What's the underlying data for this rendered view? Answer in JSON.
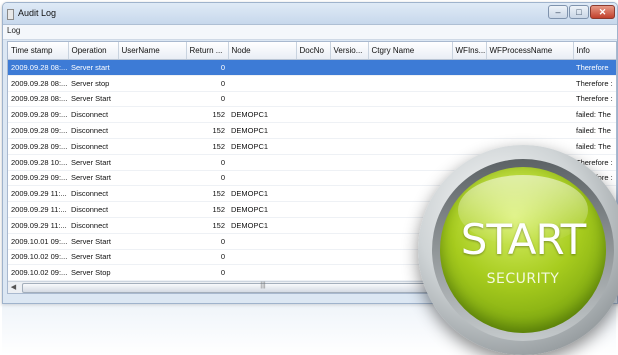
{
  "window": {
    "title": "Audit Log",
    "buttons": {
      "minimize": "–",
      "maximize": "□",
      "close": "✕"
    }
  },
  "menu": {
    "items": [
      "Log"
    ]
  },
  "table": {
    "columns": [
      "Time stamp",
      "Operation",
      "UserName",
      "Return ...",
      "Node",
      "DocNo",
      "Versio...",
      "Ctgry Name",
      "WFIns...",
      "WFProcessName",
      "Info"
    ],
    "rows": [
      [
        "2009.09.28 08:...",
        "Server start",
        "",
        "0",
        "",
        "",
        "",
        "",
        "",
        "",
        "Therefore"
      ],
      [
        "2009.09.28 08:...",
        "Server stop",
        "",
        "0",
        "",
        "",
        "",
        "",
        "",
        "",
        "Therefore :"
      ],
      [
        "2009.09.28 08:...",
        "Server Start",
        "",
        "0",
        "",
        "",
        "",
        "",
        "",
        "",
        "Therefore :"
      ],
      [
        "2009.09.28 09:...",
        "Disconnect",
        "",
        "152",
        "DEMOPC1",
        "",
        "",
        "",
        "",
        "",
        "failed: The"
      ],
      [
        "2009.09.28 09:...",
        "Disconnect",
        "",
        "152",
        "DEMOPC1",
        "",
        "",
        "",
        "",
        "",
        "failed: The"
      ],
      [
        "2009.09.28 09:...",
        "Disconnect",
        "",
        "152",
        "DEMOPC1",
        "",
        "",
        "",
        "",
        "",
        "failed: The"
      ],
      [
        "2009.09.28 10:...",
        "Server Start",
        "",
        "0",
        "",
        "",
        "",
        "",
        "",
        "",
        "Therefore :"
      ],
      [
        "2009.09.29 09:...",
        "Server Start",
        "",
        "0",
        "",
        "",
        "",
        "",
        "",
        "",
        "Therefore :"
      ],
      [
        "2009.09.29 11:...",
        "Disconnect",
        "",
        "152",
        "DEMOPC1",
        "",
        "",
        "",
        "",
        "",
        "d: The"
      ],
      [
        "2009.09.29 11:...",
        "Disconnect",
        "",
        "152",
        "DEMOPC1",
        "",
        "",
        "",
        "",
        "",
        ": The"
      ],
      [
        "2009.09.29 11:...",
        "Disconnect",
        "",
        "152",
        "DEMOPC1",
        "",
        "",
        "",
        "",
        "",
        "The"
      ],
      [
        "2009.10.01 09:...",
        "Server Start",
        "",
        "0",
        "",
        "",
        "",
        "",
        "",
        "",
        ""
      ],
      [
        "2009.10.02 09:...",
        "Server Start",
        "",
        "0",
        "",
        "",
        "",
        "",
        "",
        "",
        ""
      ],
      [
        "2009.10.02 09:...",
        "Server Stop",
        "",
        "0",
        "",
        "",
        "",
        "",
        "",
        "",
        ""
      ],
      [
        "2009.10.02 09:...",
        "Server Start",
        "",
        "0",
        "",
        "",
        "",
        "",
        "",
        "",
        ""
      ]
    ],
    "selected_row": 0
  },
  "scrollbar": {
    "left_arrow": "◀",
    "thumb_grip": "|||"
  },
  "badge": {
    "main": "START",
    "sub": "SECURITY"
  },
  "colors": {
    "selection": "#3d7bd6",
    "badge_green": "#a7cc1e",
    "window_chrome": "#dce7f3"
  }
}
